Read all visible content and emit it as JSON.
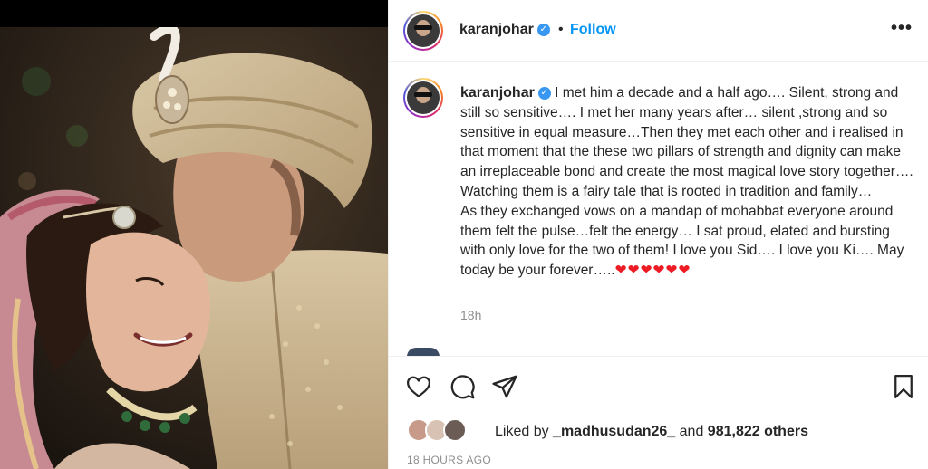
{
  "post": {
    "username": "karanjohar",
    "verified_mark": "✓",
    "dot": "•",
    "follow_label": "Follow",
    "more_label": "•••",
    "caption_text": "I met him a decade and a half ago…. Silent, strong and still so sensitive…. I met her many years after… silent ,strong and so sensitive in equal measure…Then they met each other and i realised in that moment that the these two pillars of strength and dignity can make an irreplaceable bond and create the most magical love story together…. Watching them is a fairy tale that is rooted in tradition and family…\nAs they exchanged vows on a mandap of mohabbat everyone around them felt the pulse…felt the energy… I sat proud, elated and bursting with only love for the two of them! I love you Sid…. I love you Ki…. May today be your forever…..",
    "hearts": "❤❤❤❤❤❤",
    "time_ago": "18h",
    "likes": {
      "prefix": "Liked by ",
      "user": "_madhusudan26_",
      "and": " and ",
      "count": "981,822 others"
    },
    "date": "18 HOURS AGO"
  },
  "icons": {
    "like": "heart-icon",
    "comment": "comment-icon",
    "share": "paper-plane-icon",
    "save": "bookmark-icon",
    "more": "more-dots-icon"
  },
  "colors": {
    "link": "#0095f6",
    "verified": "#3897f0",
    "heart": "#ed1c24",
    "muted": "#8e8e8e"
  }
}
